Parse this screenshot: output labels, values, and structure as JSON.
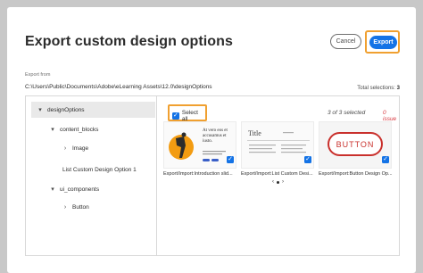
{
  "dialog": {
    "title": "Export custom design options",
    "cancel_label": "Cancel",
    "export_label": "Export",
    "export_from_label": "Export from",
    "export_path": "C:\\Users\\Public\\Documents\\Adobe\\eLearning Assets\\12.0\\designOptions",
    "total_selections_label": "Total selections:",
    "total_selections_value": "3"
  },
  "tree": {
    "items": [
      {
        "label": "designOptions",
        "chevron": "▾"
      },
      {
        "label": "content_blocks",
        "chevron": "▾"
      },
      {
        "label": "Image",
        "chevron": "›"
      },
      {
        "label": "List Custom Design Option 1",
        "chevron": ""
      },
      {
        "label": "ui_components",
        "chevron": "▾"
      },
      {
        "label": "Button",
        "chevron": "›"
      }
    ]
  },
  "content": {
    "select_all_label": "Select all",
    "selected_count": "3 of 3 selected",
    "issue_count": "0 issue",
    "cards": [
      {
        "label": "Export/Import:Introduction slid...",
        "thumb_text": "At vero eos et accusamus et iusto.",
        "checked": true
      },
      {
        "label": "Export/Import:List Custom Desi...",
        "thumb_text": "Title",
        "checked": true
      },
      {
        "label": "Export/Import:Button Design Op...",
        "thumb_text": "BUTTON",
        "checked": true
      }
    ],
    "pager_prev": "‹",
    "pager_next": "›"
  },
  "colors": {
    "accent": "#1473e6",
    "highlight": "#f0a030",
    "issue": "#d7373f",
    "thumb_orange": "#f39c12",
    "button_red": "#c9302c"
  }
}
